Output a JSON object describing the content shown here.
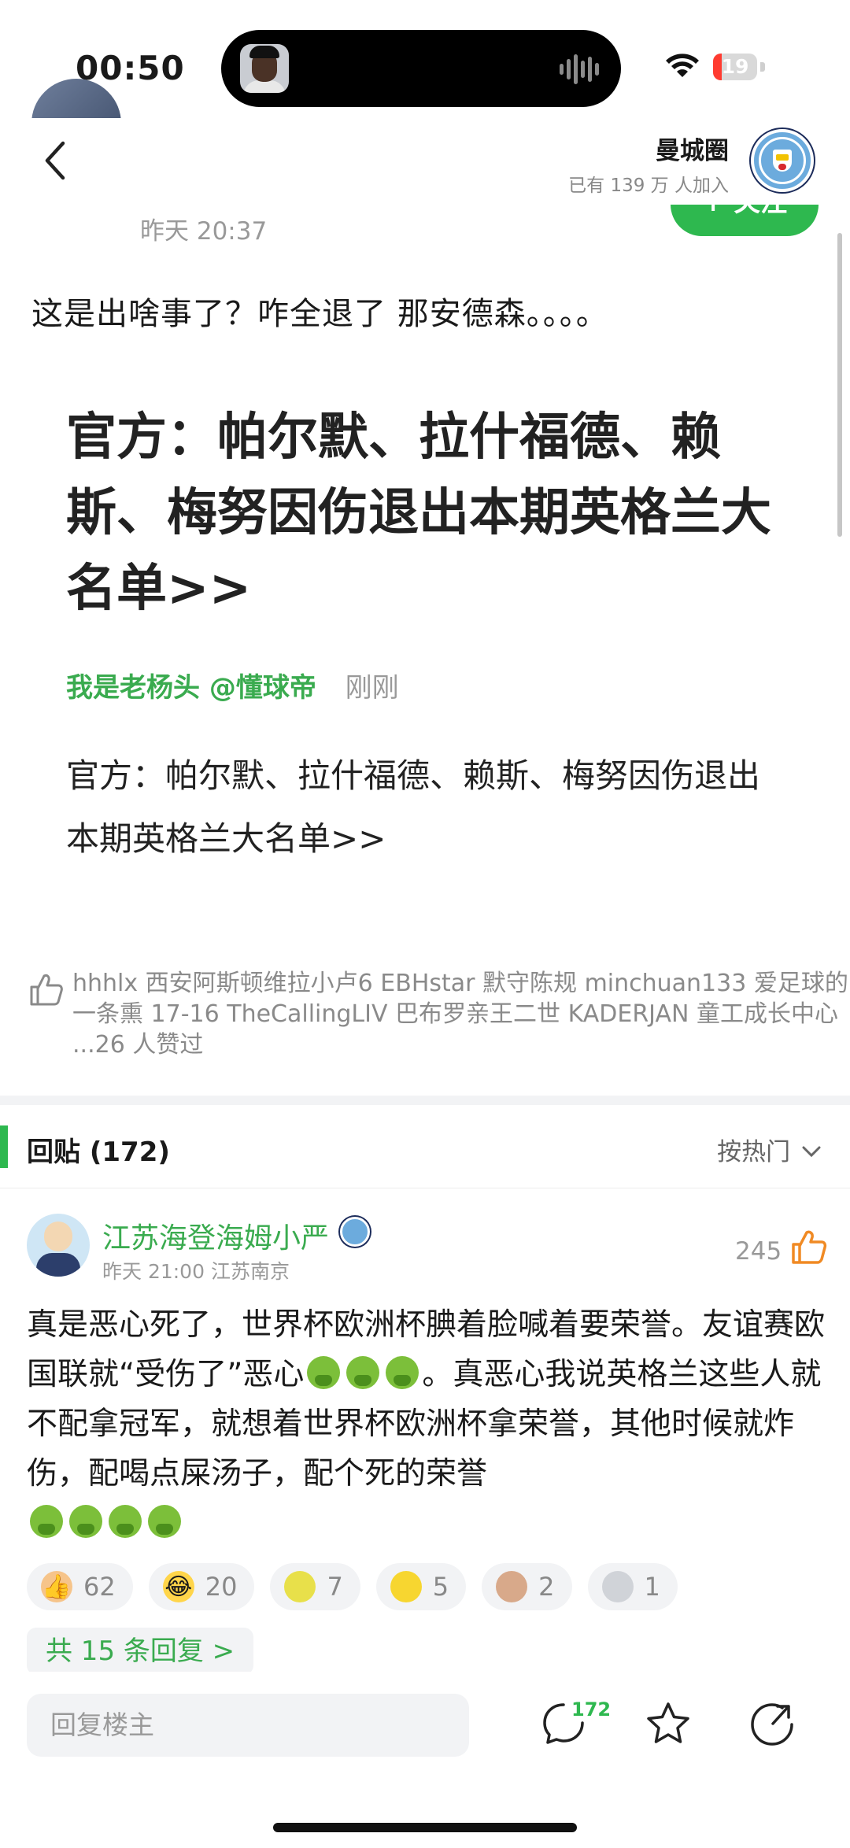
{
  "status_bar": {
    "time": "00:50",
    "battery_level": "19",
    "battery_color": "#ff3b30"
  },
  "header": {
    "circle_name": "曼城圈",
    "member_prefix": "已有",
    "member_count": "139 万",
    "member_suffix": "人加入",
    "badge_icon": "manchester-city-badge"
  },
  "post": {
    "author_time": "昨天 20:37",
    "follow_label": "+ 关注",
    "text": "这是出啥事了？咋全退了 那安德森。。。。",
    "news": {
      "title": "官方：帕尔默、拉什福德、赖斯、梅努因伤退出本期英格兰大名单>>",
      "author": "我是老杨头 @懂球帝",
      "time": "刚刚",
      "body": "官方：帕尔默、拉什福德、赖斯、梅努因伤退出本期英格兰大名单>>"
    },
    "likes_text": "hhhlx 西安阿斯顿维拉小卢6 EBHstar 默守陈规 minchuan133 爱足球的一条熏 17-16 TheCallingLIV 巴布罗亲王二世 KADERJAN 童工成长中心 ...26 人赞过"
  },
  "replies": {
    "title": "回贴 (172)",
    "sort_label": "按热门",
    "accent_color": "#2eb84f"
  },
  "comment": {
    "username": "江苏海登海姆小严",
    "meta": "昨天 21:00 江苏南京",
    "like_count": "245",
    "text_parts": [
      "真是恶心死了，世界杯欧洲杯腆着脸喊着要荣誉。友谊赛欧国联就“受伤了”恶心",
      "。真恶心我说英格兰这些人就不配拿冠军，就想着世界杯欧洲杯拿荣誉，其他时候就炸伤，配喝点屎汤子，配个死的荣誉"
    ],
    "reactions": [
      {
        "icon": "thumbs-up-icon",
        "glyph": "👍",
        "count": "62"
      },
      {
        "icon": "laugh-cry-icon",
        "glyph": "😂",
        "count": "20"
      },
      {
        "icon": "lemon-face-icon",
        "glyph": "🍋",
        "count": "7"
      },
      {
        "icon": "lemon-icon",
        "glyph": "🍋",
        "count": "5"
      },
      {
        "icon": "bald-head-icon",
        "glyph": "👴",
        "count": "2"
      },
      {
        "icon": "trophy-icon",
        "glyph": "🏆",
        "count": "1"
      }
    ],
    "more_replies": "共 15 条回复 >"
  },
  "bottom_bar": {
    "input_placeholder": "回复楼主",
    "comment_count": "172"
  }
}
